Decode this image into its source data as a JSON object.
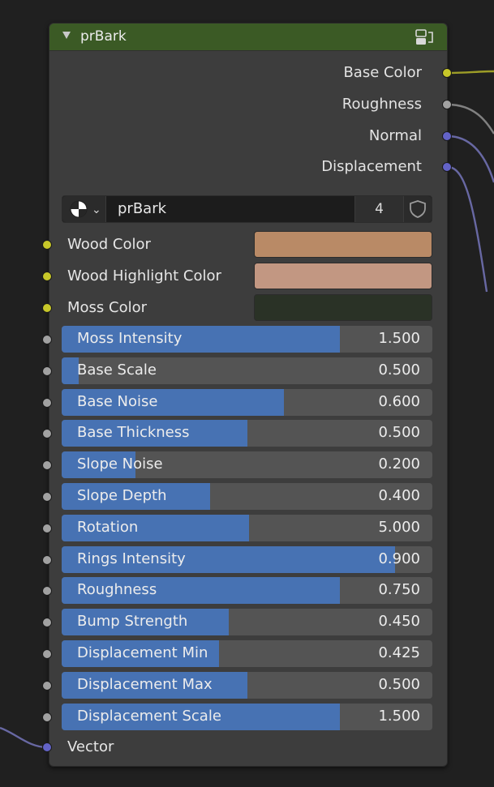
{
  "node": {
    "title": "prBark",
    "collapse_icon": "triangle-down-icon",
    "group_icon": "node-group-icon",
    "header_color": "#3b5a25"
  },
  "outputs": [
    {
      "label": "Base Color",
      "socket": "yellow"
    },
    {
      "label": "Roughness",
      "socket": "gray"
    },
    {
      "label": "Normal",
      "socket": "blue"
    },
    {
      "label": "Displacement",
      "socket": "blue"
    }
  ],
  "datablock": {
    "browse_icon": "material-sphere-icon",
    "dropdown_icon": "chevron-down-icon",
    "name": "prBark",
    "users": "4",
    "fake_user_icon": "shield-icon"
  },
  "color_inputs": [
    {
      "label": "Wood Color",
      "color": "#b98a66"
    },
    {
      "label": "Wood Highlight Color",
      "color": "#c29782"
    },
    {
      "label": "Moss Color",
      "color": "#2a3226"
    }
  ],
  "sliders": [
    {
      "label": "Moss Intensity",
      "value": "1.500",
      "fill_fraction": 0.75
    },
    {
      "label": "Base Scale",
      "value": "0.500",
      "fill_fraction": 0.045
    },
    {
      "label": "Base Noise",
      "value": "0.600",
      "fill_fraction": 0.6
    },
    {
      "label": "Base Thickness",
      "value": "0.500",
      "fill_fraction": 0.5
    },
    {
      "label": "Slope Noise",
      "value": "0.200",
      "fill_fraction": 0.2
    },
    {
      "label": "Slope Depth",
      "value": "0.400",
      "fill_fraction": 0.4
    },
    {
      "label": "Rotation",
      "value": "5.000",
      "fill_fraction": 0.505
    },
    {
      "label": "Rings Intensity",
      "value": "0.900",
      "fill_fraction": 0.9
    },
    {
      "label": "Roughness",
      "value": "0.750",
      "fill_fraction": 0.75
    },
    {
      "label": "Bump Strength",
      "value": "0.450",
      "fill_fraction": 0.45
    },
    {
      "label": "Displacement Min",
      "value": "0.425",
      "fill_fraction": 0.425
    },
    {
      "label": "Displacement Max",
      "value": "0.500",
      "fill_fraction": 0.5
    },
    {
      "label": "Displacement Scale",
      "value": "1.500",
      "fill_fraction": 0.75
    }
  ],
  "vector_input": {
    "label": "Vector",
    "socket": "blue"
  },
  "colors": {
    "socket_yellow": "#c7c729",
    "socket_gray": "#a1a1a1",
    "socket_blue": "#6363c7",
    "slider_fill": "#4772b3"
  }
}
